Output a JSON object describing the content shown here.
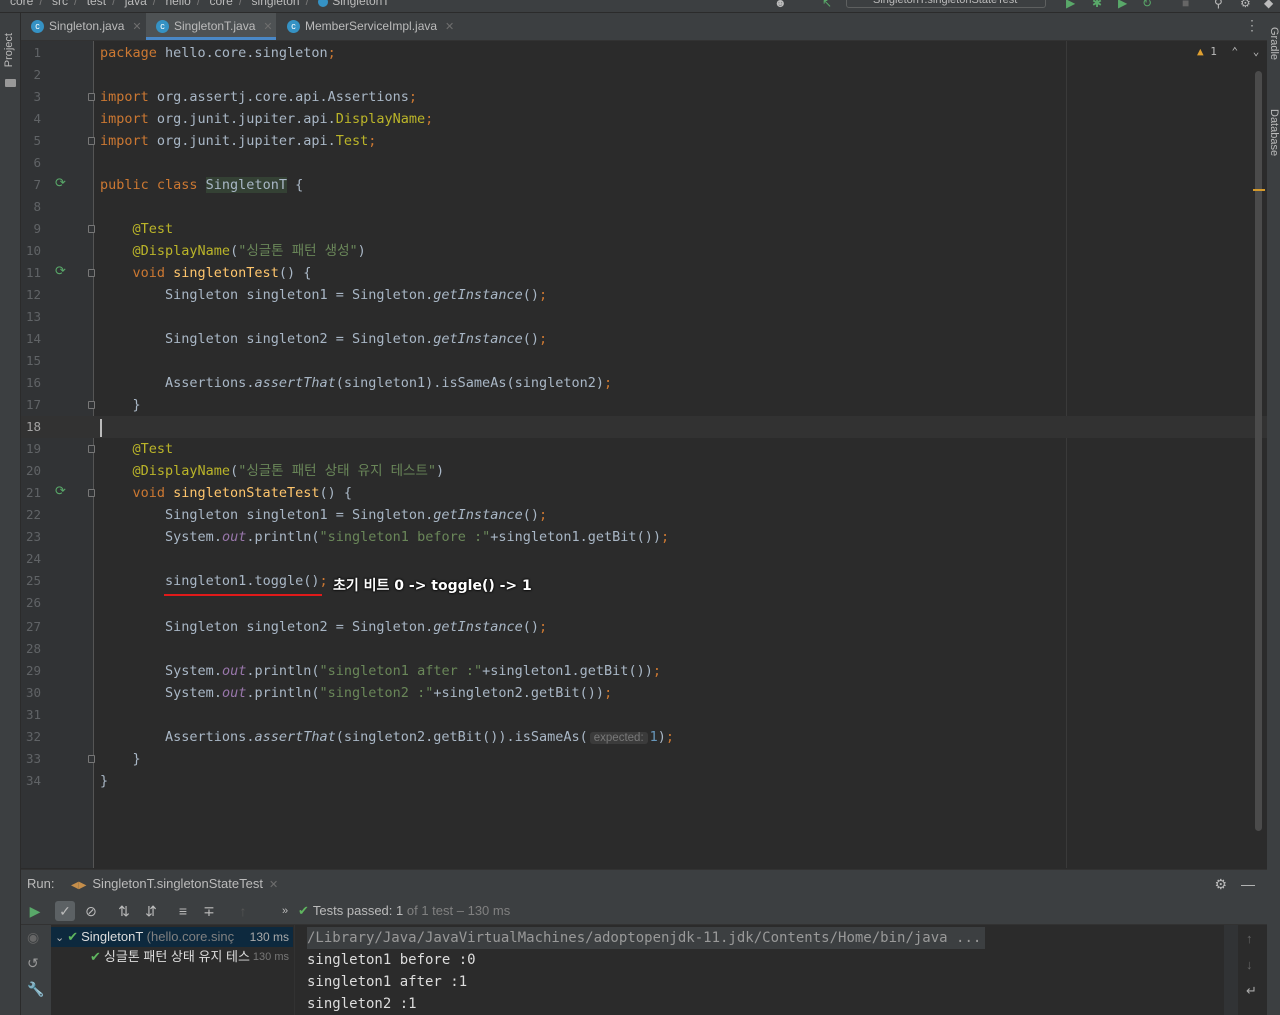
{
  "breadcrumbs": [
    "core",
    "src",
    "test",
    "java",
    "hello",
    "core",
    "singleton",
    "SingletonT"
  ],
  "run_config": "SingletonT.singletonStateTest",
  "left_strip": {
    "project_label": "Project"
  },
  "right_strip": {
    "gradle_label": "Gradle",
    "database_label": "Database"
  },
  "tabs": [
    {
      "label": "Singleton.java",
      "active": false
    },
    {
      "label": "SingletonT.java",
      "active": true
    },
    {
      "label": "MemberServiceImpl.java",
      "active": false
    }
  ],
  "editor": {
    "warning_count": "1",
    "current_line": 18,
    "overlay_note": "초기 비트 0 -> toggle() -> 1",
    "param_hint": "expected:",
    "line_numbers": [
      "1",
      "2",
      "3",
      "4",
      "5",
      "6",
      "7",
      "8",
      "9",
      "10",
      "11",
      "12",
      "13",
      "14",
      "15",
      "16",
      "17",
      "18",
      "19",
      "20",
      "21",
      "22",
      "23",
      "24",
      "25",
      "26",
      "27",
      "28",
      "29",
      "30",
      "31",
      "32",
      "33",
      "34"
    ],
    "code": {
      "l1_pkg": "hello.core.singleton",
      "l3_import": "org.assertj.core.api.Assertions",
      "l4_import_pre": "org.junit.jupiter.api.",
      "l4_import_cls": "DisplayName",
      "l5_import_pre": "org.junit.jupiter.api.",
      "l5_import_cls": "Test",
      "class_name": "SingletonT",
      "ann_test": "@Test",
      "ann_display": "@DisplayName",
      "display1": "\"싱글톤 패턴 생성\"",
      "method1": "singletonTest",
      "display2": "\"싱글톤 패턴 상태 유지 테스트\"",
      "method2": "singletonStateTest",
      "type_singleton": "Singleton",
      "var1": "singleton1",
      "var2": "singleton2",
      "get_instance": "getInstance",
      "assertions": "Assertions",
      "assert_that": "assertThat",
      "is_same_as": "isSameAs",
      "system": "System",
      "out": "out",
      "println": "println",
      "str_before": "\"singleton1 before :\"",
      "str_after": "\"singleton1 after :\"",
      "str_s2": "\"singleton2 :\"",
      "get_bit": "getBit",
      "toggle": "toggle",
      "expected_val": "1"
    }
  },
  "run_panel": {
    "label": "Run:",
    "tab": "SingletonT.singletonStateTest",
    "summary_prefix": "Tests passed:",
    "summary_count": "1",
    "summary_rest": "of 1 test – 130 ms",
    "tree": [
      {
        "name": "SingletonT",
        "pkg": "(hello.core.sinç",
        "time": "130 ms"
      },
      {
        "name": "싱글톤 패턴 상태 유지 테스",
        "time": "130 ms"
      }
    ],
    "console": [
      "/Library/Java/JavaVirtualMachines/adoptopenjdk-11.jdk/Contents/Home/bin/java ...",
      "singleton1 before :0",
      "singleton1 after :1",
      "singleton2 :1"
    ]
  }
}
